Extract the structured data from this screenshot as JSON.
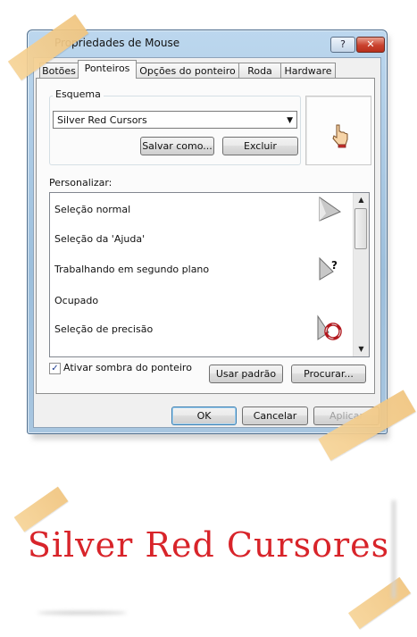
{
  "window": {
    "title": "Propriedades de Mouse",
    "help_glyph": "?",
    "close_glyph": "✕"
  },
  "tabs": [
    {
      "label": "Botões"
    },
    {
      "label": "Ponteiros"
    },
    {
      "label": "Opções do ponteiro"
    },
    {
      "label": "Roda"
    },
    {
      "label": "Hardware"
    }
  ],
  "scheme": {
    "group_label": "Esquema",
    "selected": "Silver Red Cursors",
    "save_as_label": "Salvar como...",
    "delete_label": "Excluir"
  },
  "customize": {
    "label": "Personalizar:",
    "items": [
      {
        "label": "Seleção normal",
        "icon": "arrow-pointer-icon"
      },
      {
        "label": "Seleção da 'Ajuda'",
        "icon": "help-pointer-icon"
      },
      {
        "label": "Trabalhando em segundo plano",
        "icon": "working-background-icon"
      },
      {
        "label": "Ocupado",
        "icon": "busy-ring-icon"
      },
      {
        "label": "Seleção de precisão",
        "icon": "crosshair-icon"
      }
    ]
  },
  "shadow_checkbox": {
    "label": "Ativar sombra do ponteiro",
    "checked": true
  },
  "buttons": {
    "use_default": "Usar padrão",
    "browse": "Procurar...",
    "ok": "OK",
    "cancel": "Cancelar",
    "apply": "Aplicar"
  },
  "signature": "Silver Red Cursores",
  "colors": {
    "accent_red": "#d8242a",
    "tape": "#f3cd8c"
  }
}
